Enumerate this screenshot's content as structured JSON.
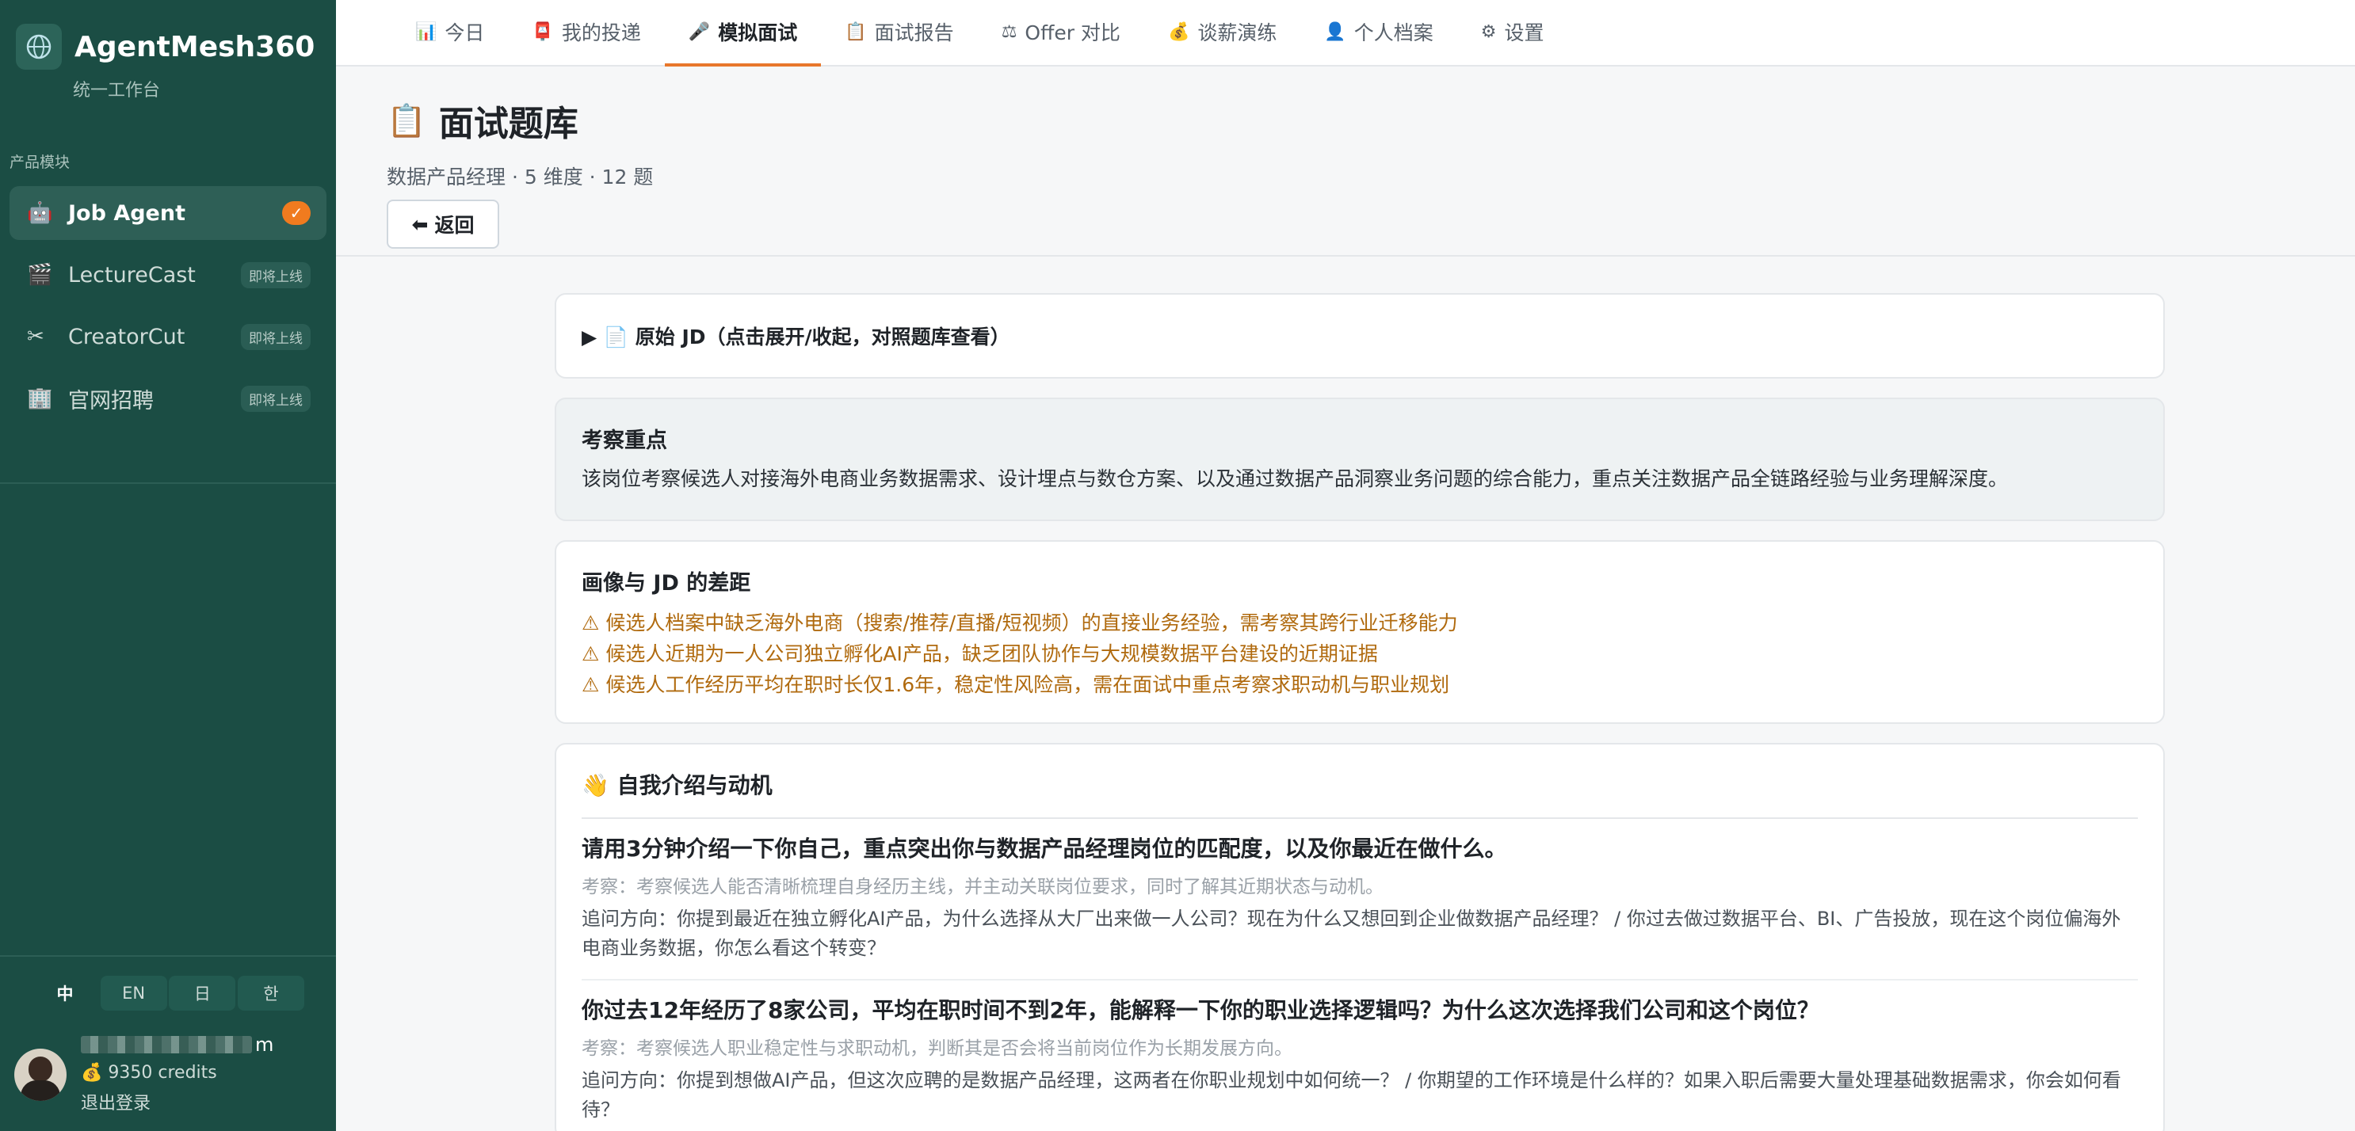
{
  "brand": {
    "title": "AgentMesh360",
    "subtitle": "统一工作台"
  },
  "sidebar": {
    "section_label": "产品模块",
    "items": [
      {
        "label": "Job Agent",
        "icon": "robot-icon",
        "glyph": "🤖",
        "badge": "✓",
        "active": true
      },
      {
        "label": "LectureCast",
        "icon": "clapper-icon",
        "glyph": "🎬",
        "badge": "即将上线"
      },
      {
        "label": "CreatorCut",
        "icon": "scissors-icon",
        "glyph": "✂",
        "badge": "即将上线"
      },
      {
        "label": "官网招聘",
        "icon": "building-icon",
        "glyph": "🏢",
        "badge": "即将上线"
      }
    ],
    "languages": [
      "中",
      "EN",
      "日",
      "한"
    ],
    "user": {
      "email_suffix": "m",
      "credits": "9350 credits",
      "logout": "退出登录"
    }
  },
  "tabs": [
    {
      "label": "今日",
      "icon": "chart-icon",
      "glyph": "📊"
    },
    {
      "label": "我的投递",
      "icon": "mailbox-icon",
      "glyph": "📮"
    },
    {
      "label": "模拟面试",
      "icon": "microphone-icon",
      "glyph": "🎤",
      "active": true
    },
    {
      "label": "面试报告",
      "icon": "report-icon",
      "glyph": "📋"
    },
    {
      "label": "Offer 对比",
      "icon": "scale-icon",
      "glyph": "⚖"
    },
    {
      "label": "谈薪演练",
      "icon": "money-bag-icon",
      "glyph": "💰"
    },
    {
      "label": "个人档案",
      "icon": "person-icon",
      "glyph": "👤"
    },
    {
      "label": "设置",
      "icon": "gear-icon",
      "glyph": "⚙"
    }
  ],
  "page": {
    "title": "面试题库",
    "meta": "数据产品经理 · 5 维度 · 12 题",
    "back_label": "返回"
  },
  "jd_toggle": "▶ 📄 原始 JD（点击展开/收起，对照题库查看）",
  "focus": {
    "title": "考察重点",
    "text": "该岗位考察候选人对接海外电商业务数据需求、设计埋点与数仓方案、以及通过数据产品洞察业务问题的综合能力，重点关注数据产品全链路经验与业务理解深度。"
  },
  "gaps": {
    "title": "画像与 JD 的差距",
    "items": [
      "⚠ 候选人档案中缺乏海外电商（搜索/推荐/直播/短视频）的直接业务经验，需考察其跨行业迁移能力",
      "⚠ 候选人近期为一人公司独立孵化AI产品，缺乏团队协作与大规模数据平台建设的近期证据",
      "⚠ 候选人工作经历平均在职时长仅1.6年，稳定性风险高，需在面试中重点考察求职动机与职业规划"
    ]
  },
  "dimension": {
    "title": "👋 自我介绍与动机",
    "questions": [
      {
        "q": "请用3分钟介绍一下你自己，重点突出你与数据产品经理岗位的匹配度，以及你最近在做什么。",
        "test": "考察：考察候选人能否清晰梳理自身经历主线，并主动关联岗位要求，同时了解其近期状态与动机。",
        "follow": "追问方向：你提到最近在独立孵化AI产品，为什么选择从大厂出来做一人公司？现在为什么又想回到企业做数据产品经理？ / 你过去做过数据平台、BI、广告投放，现在这个岗位偏海外电商业务数据，你怎么看这个转变？"
      },
      {
        "q": "你过去12年经历了8家公司，平均在职时间不到2年，能解释一下你的职业选择逻辑吗？为什么这次选择我们公司和这个岗位？",
        "test": "考察：考察候选人职业稳定性与求职动机，判断其是否会将当前岗位作为长期发展方向。",
        "follow": "追问方向：你提到想做AI产品，但这次应聘的是数据产品经理，这两者在你职业规划中如何统一？ / 你期望的工作环境是什么样的？如果入职后需要大量处理基础数据需求，你会如何看待？"
      }
    ]
  }
}
